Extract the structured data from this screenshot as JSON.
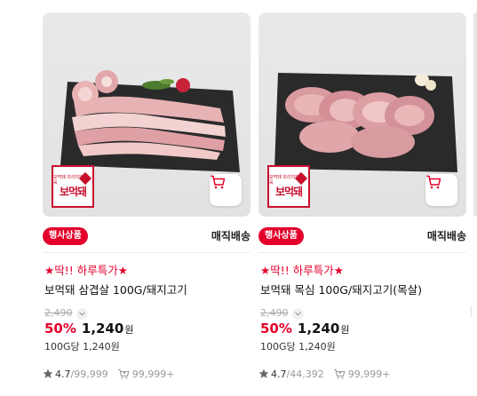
{
  "products": [
    {
      "brand_logo_text": "보먹돼",
      "brand_small_text": "보먹돼 프리미엄 돈육",
      "event_tag": "행사상품",
      "delivery": "매직배송",
      "promo": "★딱!! 하루특가★",
      "title": "보먹돼 삼겹살 100G/돼지고기",
      "original_price": "2,490",
      "discount": "50%",
      "price": "1,240",
      "currency": "원",
      "unit_price": "100G당 1,240원",
      "rating": "4.7",
      "review_count": "99,999",
      "likes": "99,999+"
    },
    {
      "brand_logo_text": "보먹돼",
      "brand_small_text": "보먹돼 프리미엄 돈육",
      "event_tag": "행사상품",
      "delivery": "매직배송",
      "promo": "★딱!! 하루특가★",
      "title": "보먹돼 목심 100G/돼지고기(목살)",
      "original_price": "2,490",
      "discount": "50%",
      "price": "1,240",
      "currency": "원",
      "unit_price": "100G당 1,240원",
      "rating": "4.7",
      "review_count": "44,392",
      "likes": "99,999+"
    }
  ],
  "icons": {
    "cart": "cart-icon",
    "star": "star-icon",
    "likes": "heart-cart-icon",
    "chevron": "chevron-down-icon"
  },
  "colors": {
    "accent_red": "#e4002b",
    "brand_red": "#c8102e",
    "meta_gray": "#999999"
  },
  "separator": "/"
}
